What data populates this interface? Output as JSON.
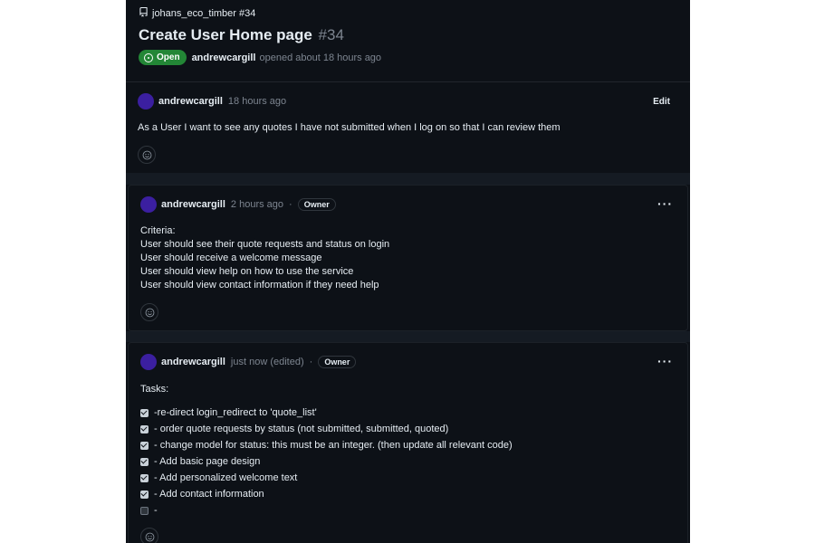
{
  "repo": {
    "name": "johans_eco_timber #34"
  },
  "issue": {
    "title": "Create User Home page",
    "number": "#34",
    "status": "Open",
    "author": "andrewcargill",
    "opened_text": "opened about 18 hours ago"
  },
  "comments": [
    {
      "author": "andrewcargill",
      "time": "18 hours ago",
      "action": "Edit",
      "body": "As a User I want to see any quotes I have not submitted when I log on so that I can review them"
    },
    {
      "author": "andrewcargill",
      "time": "2 hours ago",
      "role": "Owner",
      "lines": [
        "Criteria:",
        "User should see their quote requests and status on login",
        "User should receive a welcome message",
        "User should view help on how to use the service",
        "User should view contact information if they need help"
      ]
    },
    {
      "author": "andrewcargill",
      "time": "just now (edited)",
      "role": "Owner",
      "heading": "Tasks:",
      "tasks": [
        {
          "label": "-re-direct login_redirect to 'quote_list'",
          "checked": true
        },
        {
          "label": "- order quote requests by status (not submitted, submitted, quoted)",
          "checked": true
        },
        {
          "label": "- change model for status: this must be an integer. (then update all relevant code)",
          "checked": true
        },
        {
          "label": "- Add basic page design",
          "checked": true
        },
        {
          "label": "- Add personalized welcome text",
          "checked": true
        },
        {
          "label": "- Add contact information",
          "checked": true
        },
        {
          "label": "-",
          "checked": false
        }
      ]
    }
  ],
  "icons": {
    "repo": "repo-icon",
    "status": "issue-open-icon",
    "reaction": "smiley-icon",
    "menu": "kebab-icon"
  },
  "colors": {
    "background": "#0d1117",
    "open_badge": "#238636",
    "avatar": "#3b1fa0",
    "muted_text": "#7d8590"
  }
}
